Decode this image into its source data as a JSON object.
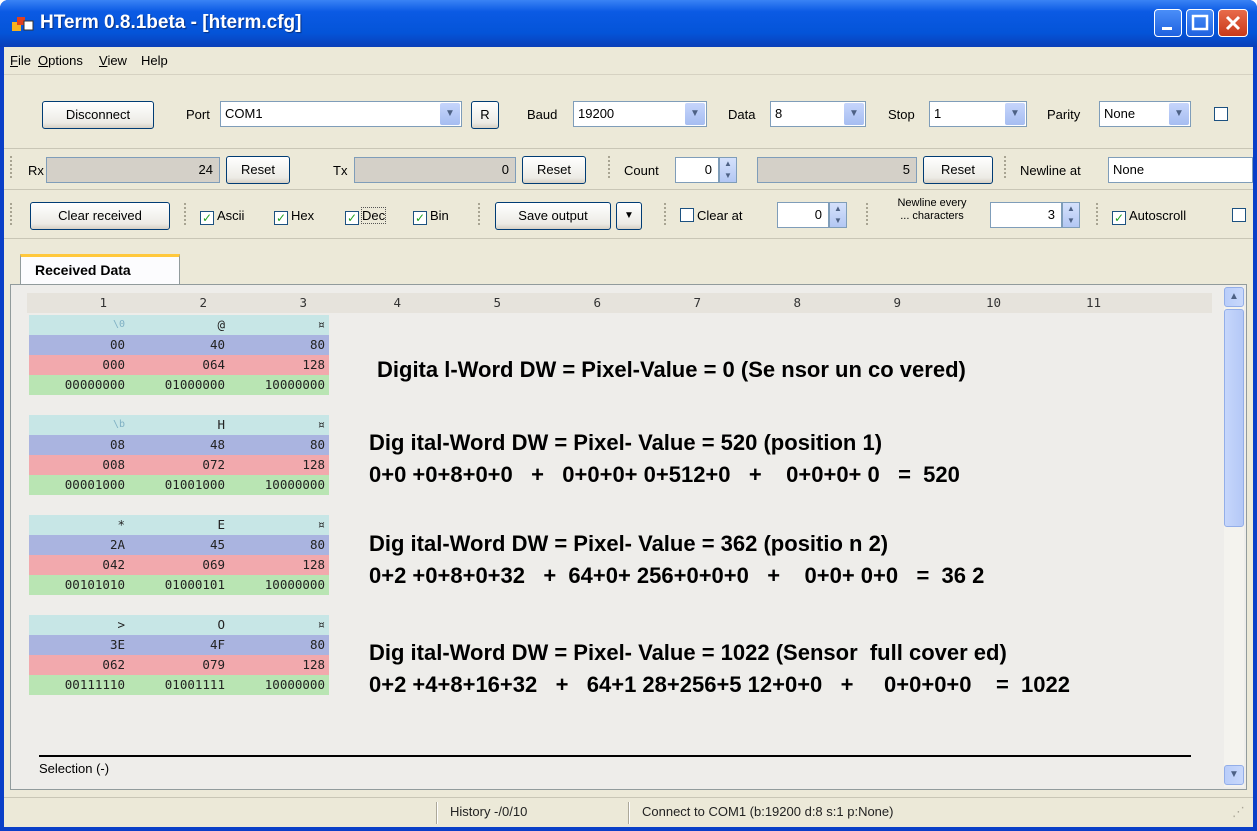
{
  "window": {
    "title": "HTerm 0.8.1beta - [hterm.cfg]"
  },
  "menu": [
    {
      "label": "File",
      "key": "F",
      "rest": "ile"
    },
    {
      "label": "Options",
      "key": "O",
      "rest": "ptions"
    },
    {
      "label": "View",
      "key": "V",
      "rest": "iew"
    },
    {
      "label": "Help",
      "key": "",
      "rest": "Help"
    }
  ],
  "connection": {
    "disconnect_label": "Disconnect",
    "port_label": "Port",
    "port_value": "COM1",
    "refresh_label": "R",
    "baud_label": "Baud",
    "baud_value": "19200",
    "data_label": "Data",
    "data_value": "8",
    "stop_label": "Stop",
    "stop_value": "1",
    "parity_label": "Parity",
    "parity_value": "None"
  },
  "counters": {
    "rx_label": "Rx",
    "rx_value": "24",
    "rx_reset": "Reset",
    "tx_label": "Tx",
    "tx_value": "0",
    "tx_reset": "Reset",
    "count_label": "Count",
    "count_value": "0",
    "count_total": "5",
    "count_reset": "Reset",
    "newline_label": "Newline at",
    "newline_value": "None"
  },
  "display": {
    "clear_received": "Clear received",
    "ascii": "Ascii",
    "hex": "Hex",
    "dec": "Dec",
    "bin": "Bin",
    "save_output": "Save output",
    "clear_at": "Clear at",
    "clear_at_value": "0",
    "newline_every_1": "Newline every",
    "newline_every_2": "... characters",
    "newline_every_value": "3",
    "autoscroll": "Autoscroll"
  },
  "tab": {
    "label": "Received Data"
  },
  "columns": [
    "1",
    "2",
    "3",
    "4",
    "5",
    "6",
    "7",
    "8",
    "9",
    "10",
    "11"
  ],
  "rows": [
    [
      {
        "ascii": "\\0",
        "hex": "00",
        "dec": "000",
        "bin": "00000000"
      },
      {
        "ascii": "@",
        "hex": "40",
        "dec": "064",
        "bin": "01000000"
      },
      {
        "ascii": "¤",
        "hex": "80",
        "dec": "128",
        "bin": "10000000"
      }
    ],
    [
      {
        "ascii": "\\b",
        "hex": "08",
        "dec": "008",
        "bin": "00001000"
      },
      {
        "ascii": "H",
        "hex": "48",
        "dec": "072",
        "bin": "01001000"
      },
      {
        "ascii": "¤",
        "hex": "80",
        "dec": "128",
        "bin": "10000000"
      }
    ],
    [
      {
        "ascii": "*",
        "hex": "2A",
        "dec": "042",
        "bin": "00101010"
      },
      {
        "ascii": "E",
        "hex": "45",
        "dec": "069",
        "bin": "01000101"
      },
      {
        "ascii": "¤",
        "hex": "80",
        "dec": "128",
        "bin": "10000000"
      }
    ],
    [
      {
        "ascii": ">",
        "hex": "3E",
        "dec": "062",
        "bin": "00111110"
      },
      {
        "ascii": "O",
        "hex": "4F",
        "dec": "079",
        "bin": "01001111"
      },
      {
        "ascii": "¤",
        "hex": "80",
        "dec": "128",
        "bin": "10000000"
      }
    ]
  ],
  "annotations": [
    {
      "line1": "Digita l-Word DW = Pixel-Value = 0 (Se nsor un co vered)",
      "line2": ""
    },
    {
      "line1": "Dig ital-Word DW = Pixel- Value = 520 (position 1)",
      "line2": "0+0 +0+8+0+0   +   0+0+0+ 0+512+0   +    0+0+0+ 0   =  520"
    },
    {
      "line1": "Dig ital-Word DW = Pixel- Value = 362 (positio n 2)",
      "line2": "0+2 +0+8+0+32   +  64+0+ 256+0+0+0   +    0+0+ 0+0   =  36 2"
    },
    {
      "line1": "Dig ital-Word DW = Pixel- Value = 1022 (Sensor  full cover ed)",
      "line2": "0+2 +4+8+16+32   +   64+1 28+256+5 12+0+0   +     0+0+0+0    =  1022"
    }
  ],
  "selection": "Selection (-)",
  "status": {
    "history": "History -/0/10",
    "connect": "Connect to COM1 (b:19200 d:8 s:1 p:None)"
  }
}
